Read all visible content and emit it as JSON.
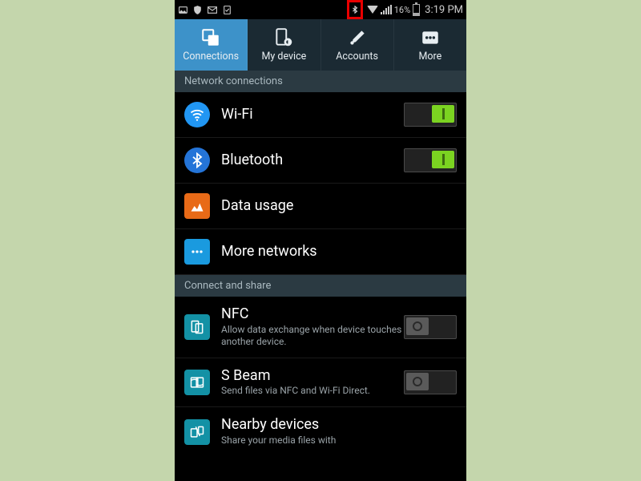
{
  "status": {
    "battery_pct": "16%",
    "time": "3:19 PM"
  },
  "tabs": {
    "connections": "Connections",
    "mydevice": "My device",
    "accounts": "Accounts",
    "more": "More"
  },
  "sections": {
    "network": "Network connections",
    "share": "Connect and share"
  },
  "items": {
    "wifi": {
      "title": "Wi-Fi",
      "on": true
    },
    "bluetooth": {
      "title": "Bluetooth",
      "on": true
    },
    "datausage": {
      "title": "Data usage"
    },
    "morenet": {
      "title": "More networks"
    },
    "nfc": {
      "title": "NFC",
      "sub": "Allow data exchange when device touches another device.",
      "on": false
    },
    "sbeam": {
      "title": "S Beam",
      "sub": "Send files via NFC and Wi-Fi Direct.",
      "on": false
    },
    "nearby": {
      "title": "Nearby devices",
      "sub": "Share your media files with"
    }
  }
}
